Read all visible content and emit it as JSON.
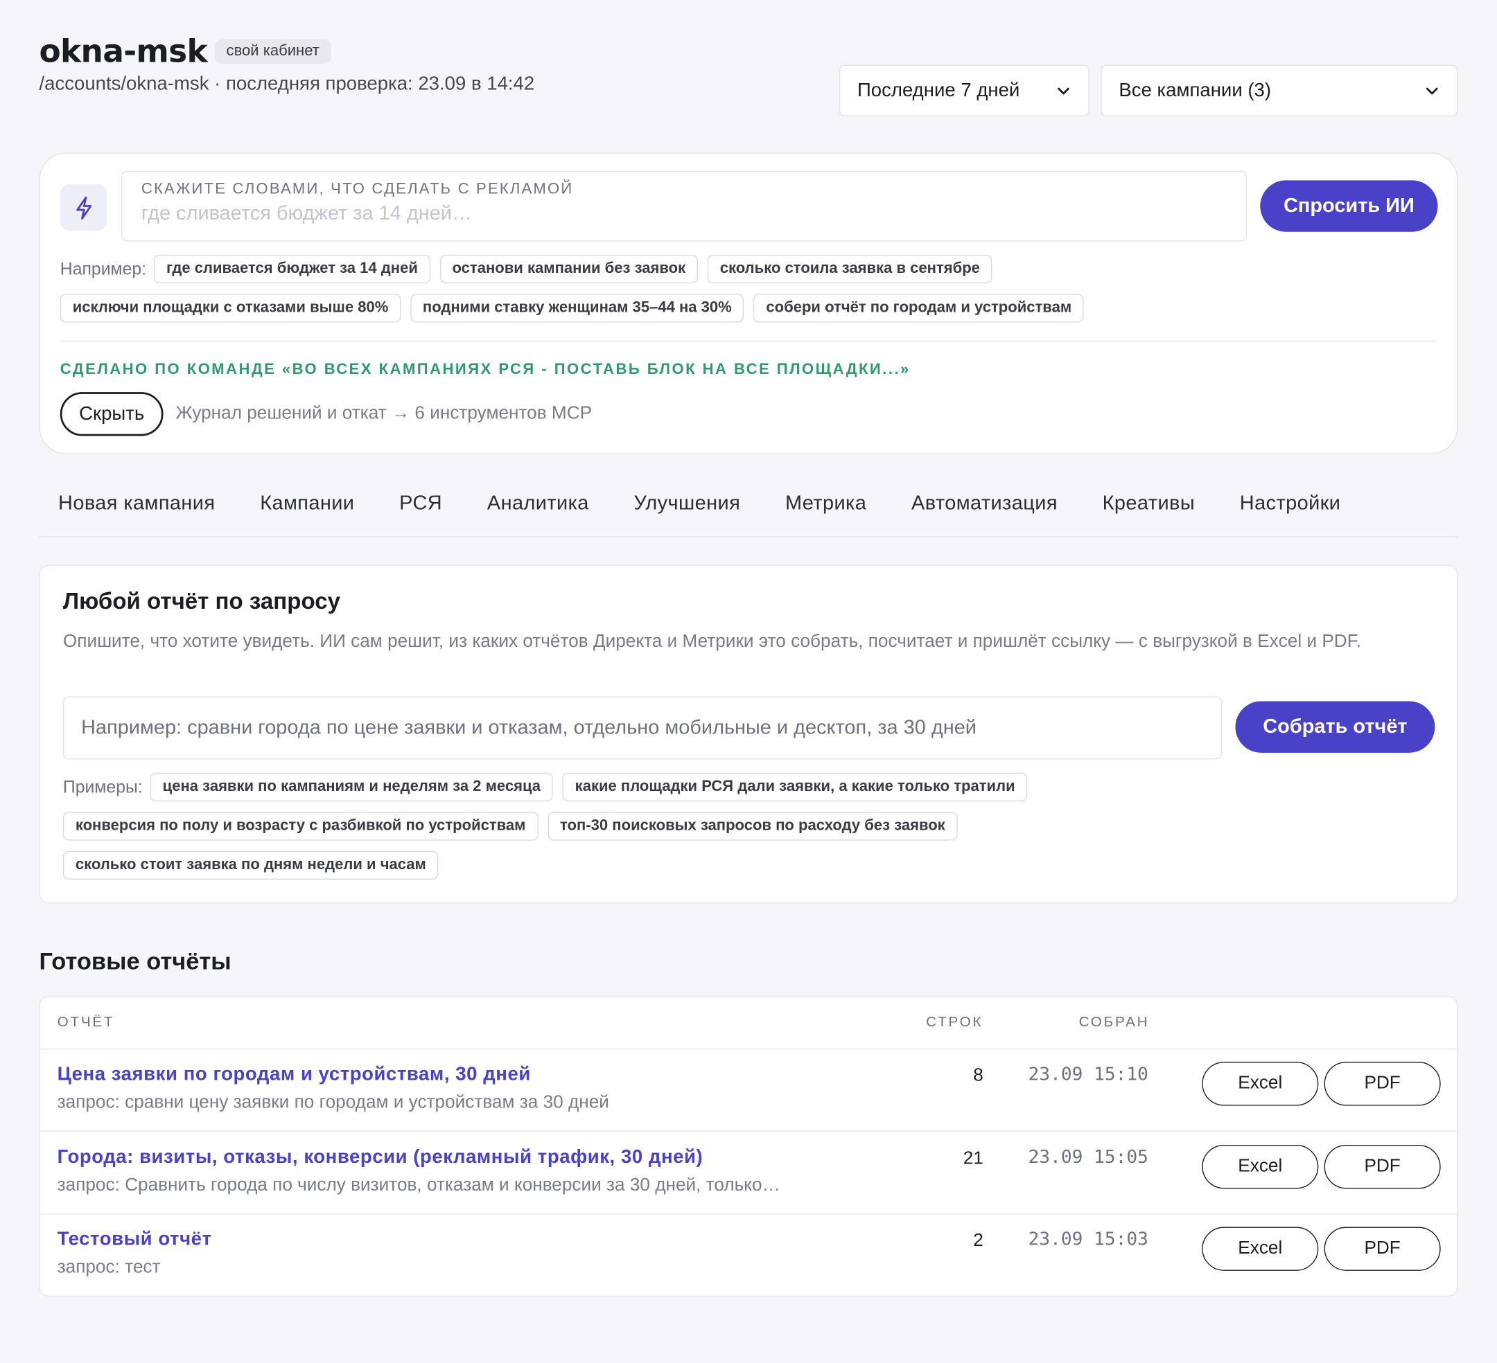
{
  "header": {
    "title": "okna-msk",
    "badge": "свой кабинет",
    "subtitle": "/accounts/okna-msk · последняя проверка: 23.09 в 14:42",
    "period": "Последние 7 дней",
    "campaigns": "Все кампании (3)"
  },
  "ai": {
    "input_label": "Скажите словами, что сделать с рекламой",
    "input_placeholder": "где сливается бюджет за 14 дней…",
    "ask_button": "Спросить ИИ",
    "examples_lead": "Например:",
    "examples": [
      "где сливается бюджет за 14 дней",
      "останови кампании без заявок",
      "сколько стоила заявка в сентябре",
      "исключи площадки с отказами выше 80%",
      "подними ставку женщинам 35–44 на 30%",
      "собери отчёт по городам и устройствам"
    ],
    "done_text": "Сделано по команде «во всех кампаниях РСЯ - поставь блок на все площадки...»",
    "hide_button": "Скрыть",
    "journal": "Журнал решений и откат → 6 инструментов MCP"
  },
  "tabs": [
    "Новая кампания",
    "Кампании",
    "РСЯ",
    "Аналитика",
    "Улучшения",
    "Метрика",
    "Автоматизация",
    "Креативы",
    "Настройки"
  ],
  "report_request": {
    "title": "Любой отчёт по запросу",
    "description": "Опишите, что хотите увидеть. ИИ сам решит, из каких отчётов Директа и Метрики это собрать, посчитает и пришлёт ссылку — с выгрузкой в Excel и PDF.",
    "input_placeholder": "Например: сравни города по цене заявки и отказам, отдельно мобильные и десктоп, за 30 дней",
    "button": "Собрать отчёт",
    "examples_lead": "Примеры:",
    "examples": [
      "цена заявки по кампаниям и неделям за 2 месяца",
      "какие площадки РСЯ дали заявки, а какие только тратили",
      "конверсия по полу и возрасту с разбивкой по устройствам",
      "топ-30 поисковых запросов по расходу без заявок",
      "сколько стоит заявка по дням недели и часам"
    ]
  },
  "ready": {
    "title": "Готовые отчёты",
    "columns": {
      "report": "ОТЧЁТ",
      "rows": "СТРОК",
      "collected": "СОБРАН"
    },
    "rows": [
      {
        "name": "Цена заявки по городам и устройствам, 30 дней",
        "query": "запрос: сравни цену заявки по городам и устройствам за 30 дней",
        "count": "8",
        "date": "23.09 15:10",
        "excel": "Excel",
        "pdf": "PDF"
      },
      {
        "name": "Города: визиты, отказы, конверсии (рекламный трафик, 30 дней)",
        "query": "запрос: Сравнить города по числу визитов, отказам и конверсии за 30 дней, только…",
        "count": "21",
        "date": "23.09 15:05",
        "excel": "Excel",
        "pdf": "PDF"
      },
      {
        "name": "Тестовый отчёт",
        "query": "запрос: тест",
        "count": "2",
        "date": "23.09 15:03",
        "excel": "Excel",
        "pdf": "PDF"
      }
    ]
  },
  "colors": {
    "accent": "#4942c9",
    "success": "#2e9c6a",
    "background": "#f6f6fa"
  }
}
